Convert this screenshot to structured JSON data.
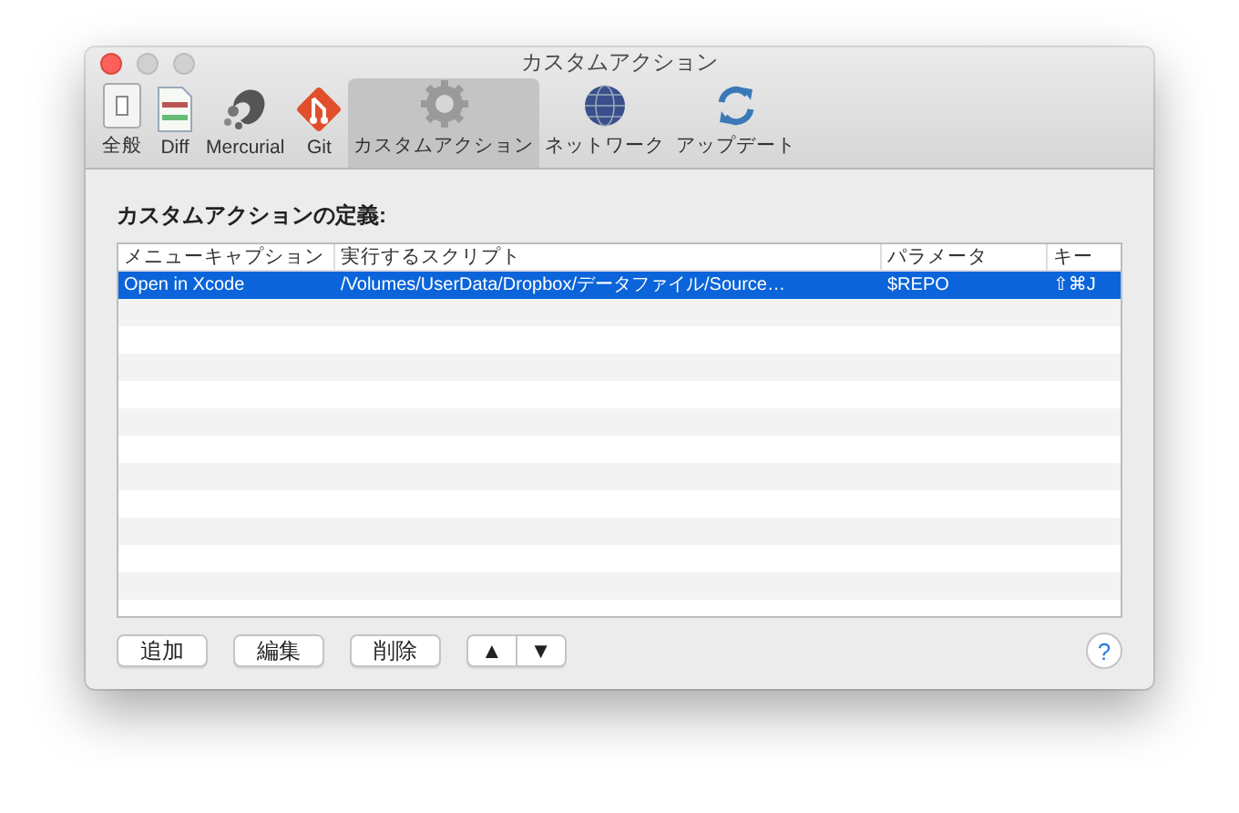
{
  "window": {
    "title": "カスタムアクション"
  },
  "toolbar": [
    {
      "kind": "general",
      "label": "全般",
      "selected": false
    },
    {
      "kind": "diff",
      "label": "Diff",
      "selected": false
    },
    {
      "kind": "mercurial",
      "label": "Mercurial",
      "selected": false
    },
    {
      "kind": "git",
      "label": "Git",
      "selected": false
    },
    {
      "kind": "gear",
      "label": "カスタムアクション",
      "selected": true
    },
    {
      "kind": "globe",
      "label": "ネットワーク",
      "selected": false
    },
    {
      "kind": "update",
      "label": "アップデート",
      "selected": false
    }
  ],
  "heading": "カスタムアクションの定義:",
  "table": {
    "columns": [
      "メニューキャプション",
      "実行するスクリプト",
      "パラメータ",
      "キー"
    ],
    "rows": [
      {
        "cells": [
          "Open in Xcode",
          "/Volumes/UserData/Dropbox/データファイル/Source…",
          "$REPO",
          "⇧⌘J"
        ],
        "selected": true
      }
    ]
  },
  "buttons": [
    "追加",
    "編集",
    "削除"
  ],
  "move_buttons": [
    "▲",
    "▼"
  ],
  "help": "?"
}
